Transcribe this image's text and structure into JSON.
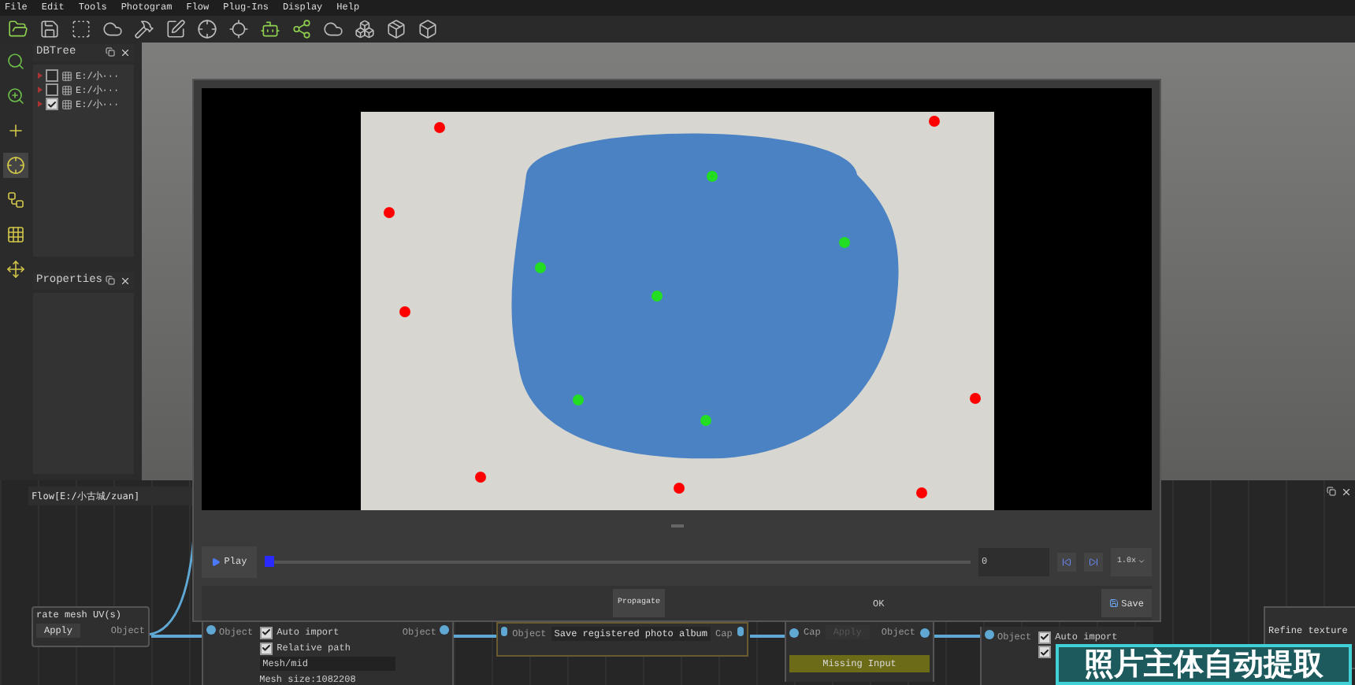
{
  "menu": [
    "File",
    "Edit",
    "Tools",
    "Photogram",
    "Flow",
    "Plug-Ins",
    "Display",
    "Help"
  ],
  "tools": [
    {
      "selected": false
    },
    {
      "selected": false
    },
    {
      "selected": false
    },
    {
      "selected": true
    },
    {
      "selected": false
    },
    {
      "selected": false
    },
    {
      "selected": false
    }
  ],
  "db_tree": {
    "title": "DBTree",
    "items": [
      {
        "label": "E:/小···",
        "checked": false
      },
      {
        "label": "E:/小···",
        "checked": false
      },
      {
        "label": "E:/小···",
        "checked": true
      }
    ]
  },
  "properties": {
    "title": "Properties"
  },
  "flow_panel": {
    "title": "Flow[E:/小古城/zuan]"
  },
  "dialog": {
    "play": "Play",
    "level": 0,
    "frame": "0",
    "speed": "1.0x",
    "propagate": "Propagate",
    "status": "OK",
    "save": "Save"
  },
  "nodes": {
    "uv": {
      "title": "rate mesh UV(s)",
      "button": "Apply",
      "output": "Object"
    },
    "import": {
      "input": "Object",
      "options": [
        {
          "label": "Auto import",
          "checked": true
        },
        {
          "label": "Relative path",
          "checked": true
        }
      ],
      "path": "Mesh/mid",
      "info": "Mesh size:1082208",
      "output": "Object"
    },
    "album": {
      "input": "Object",
      "label": "Save registered photo album",
      "output": "Cap"
    },
    "apply": {
      "input": "Cap",
      "button": "Apply",
      "disabled": true,
      "output": "Object",
      "status": "Missing Input"
    },
    "import2": {
      "input": "Object",
      "options": [
        {
          "label": "Auto import",
          "checked": true
        },
        {
          "checked": true
        }
      ]
    },
    "refine": {
      "title": "Refine texture"
    }
  },
  "subtitle": "照片主体自动提取"
}
